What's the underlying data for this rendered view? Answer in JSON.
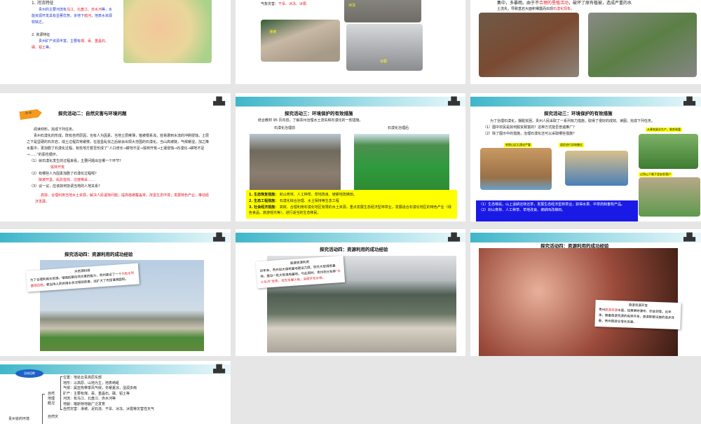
{
  "s1": {
    "heading": "1. 河流特征",
    "p1a": "贵州的主要河流有",
    "p1b": "乌江、北盘江、赤水河",
    "p1c": "等，水能资源开发具有显著优势。多地下",
    "p1d": "暗河",
    "p1e": "，地表水资源较缺乏。",
    "h2": "2. 资源特征",
    "p2a": "贵州矿产资源丰富，主要有",
    "p2b": "煤、汞、重晶石、磷、铝土",
    "p2c": "等。"
  },
  "s2": {
    "line_label": "气象灾害：",
    "line_value": "干旱、冰冻、冰雹",
    "img1": "滑坡",
    "img2": "冰雹",
    "img3": "冰冻"
  },
  "s3": {
    "line1a": "集中，多暴雨。由于不",
    "line1b": "合理的垦殖活动",
    "line1c": "，破坏了原有植被，造成严重的水",
    "line2a": "土流失，导致基岩大面积裸露而出现",
    "line2b": "石漠化现象",
    "line2c": "。"
  },
  "s4": {
    "tag": "活 动",
    "title": "探究活动二：自然灾害与环境问题",
    "intro": "阅读材料，完成下列任务。",
    "para": "贵州石漠化的形成，既有自然原因，也有人为因素。当地土层瘠薄，植被根系浅，容易遭到水流的冲刷侵蚀，土层之下是坚硬的石灰岩，成土过程异常缓慢，在滥垦乱伐之后就会出现大范围的石漠化。当山高坡陡，气候暖湿，加之降水集中，更加剧了石漠化过程。有些地方甚至形成了“人口增长→耕地不足→毁林开荒→土壤侵蚀→石漠化→耕地不足→……”的恶性循环。",
    "q1": "（1）就石漠化发生的过程来看，主要问题出在哪一个环节？",
    "a1": "毁林开荒",
    "q2": "（2）有哪些人为因素加剧了石漠化过程呢？",
    "a2": "陡坡开垦、乱砍滥伐、过度樵采……",
    "q3": "（3）议一议，应该如何协调当地的人地关系？",
    "a3": "高效、合理利用当地水土资源，解决人民温饱问题；提高植被覆盖率，改善生态环境；发展特色产业，推动经济发展。"
  },
  "s5": {
    "title": "探究活动三：环境保护的有效措施",
    "intro": "结合教材 95 页内容，了解贵州治理水土流失和石漠化的一些措施。",
    "cap1": "石漠化治理前",
    "cap2": "石漠化治理后",
    "m1k": "1. 生态恢复措施：",
    "m1v": "封山育林、人工种草、草地改良、坡耕地改梯田。",
    "m2k": "2. 生态工程措施：",
    "m2v": "石漠化综合治理、水土保持等生态工程",
    "m3k": "3. 社会经济措施：",
    "m3v": "高效、合理利用石漠化地区有限的水土资源，重点发展生态经济型林草业，发展适合石漠化地区的特色产业（绿色食品、旅游观光等），进行适当的生态移民。"
  },
  "s6": {
    "title": "探究活动三：环境保护的有效措施",
    "intro": "为了治理石漠化，摆脱贫困，贵州人民采取了一系列有力措施，取得了很好的成效。读图，完成下列任务。",
    "q1": "（1）图中农民是如何脱贫致富的？这种方式能否普遍推广？",
    "q2": "（2）除了图示中的措施，治理石漠化还可以采取哪些措施？",
    "l1": "贫困山区石漠化严重",
    "l2": "居民进行异地搬迁",
    "l3": "从事农副业生产，脱贫致富",
    "l4": "过到山下搬子里安家落户",
    "a1": "（1）生态移民。山上退耕还林还草，发展生态经济型林草业，获得水果、中草药和畜牧产品。",
    "a2": "（2）封山育林、人工种草、草地改良、坡耕田改梯田。"
  },
  "s7": {
    "title": "探究活动四：资源利用的成功经验",
    "note_title": "水资源利用",
    "note_a": "为了合理利用水资源，增强抵御自然灾害的能力，贵州建设了一个",
    "note_b": "大批水利基础设施",
    "note_c": "，使当地人民的用水状况得到改善，还扩大了农田灌溉面积。"
  },
  "s8": {
    "title": "探究活动四：资源利用的成功经验",
    "note_title": "能源资源利用",
    "note_a": "近年来，贵州加大煤炭基地建设力度，依托大型煤炭基地，建设一批大型煤电基地。与此同时，贵州充分发挥",
    "note_b": "“水火互济”优势，优先发展火电，深度开发水电。"
  },
  "s9": {
    "title": "探究活动四：资源利用的成功经验",
    "note_title": "旅游资源开发",
    "note_a": "贵州",
    "note_b": "旅游资源",
    "note_c": "丰富，如黄果树瀑布、织金洞等。近年来，随着旅游资源的有序开发，旅游配套设施的逐步改善，贵州旅游业增长迅速。"
  },
  "s10": {
    "badge": "总结回眸",
    "root": "贵州省的环境",
    "b1": "自然地理概况",
    "b2": "自然灾",
    "items": [
      "位置：地处云贵高原东部",
      "地形：以高原、山地为主，地表崎岖",
      "气候：属亚热带季风气候，冬暖夏凉，湿润多雨",
      "矿产：主要有煤、汞、重晶石、磷、铝土等",
      "河流：有乌江、北盘江、赤水河等",
      "地貌：喀斯特地貌广泛发育",
      "自然灾害：滑坡、泥石流、干旱、冰冻、冰雹等灾害性天气"
    ]
  }
}
